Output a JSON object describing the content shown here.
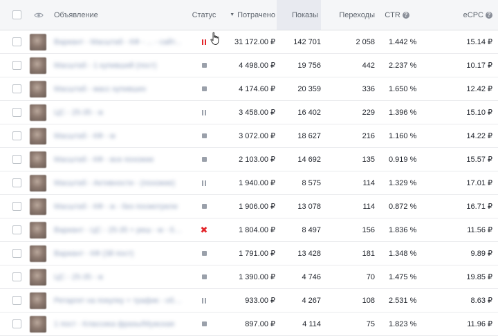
{
  "header": {
    "ad": "Объявление",
    "status": "Статус",
    "spent": "Потрачено",
    "shows": "Показы",
    "clicks": "Переходы",
    "ctr": "CTR",
    "ecpc": "eCPC",
    "help_glyph": "?",
    "sort_glyph": "▼"
  },
  "status_glyphs": {
    "error": "✖"
  },
  "rows": [
    {
      "name": "Вариант - Масштаб - КФ - ... - сайт...",
      "status": "pause-red",
      "spent": "31 172.00 ₽",
      "shows": "142 701",
      "clicks": "2 058",
      "ctr": "1.442 %",
      "ecpc": "15.14 ₽"
    },
    {
      "name": "Масштаб - 1 купивший (пост)",
      "status": "stop",
      "spent": "4 498.00 ₽",
      "shows": "19 756",
      "clicks": "442",
      "ctr": "2.237 %",
      "ecpc": "10.17 ₽"
    },
    {
      "name": "Масштаб - масс купивших",
      "status": "stop",
      "spent": "4 174.60 ₽",
      "shows": "20 359",
      "clicks": "336",
      "ctr": "1.650 %",
      "ecpc": "12.42 ₽"
    },
    {
      "name": "ЦС - 25-35 - ж",
      "status": "pause",
      "spent": "3 458.00 ₽",
      "shows": "16 402",
      "clicks": "229",
      "ctr": "1.396 %",
      "ecpc": "15.10 ₽"
    },
    {
      "name": "Масштаб - КФ - м",
      "status": "stop",
      "spent": "3 072.00 ₽",
      "shows": "18 627",
      "clicks": "216",
      "ctr": "1.160 %",
      "ecpc": "14.22 ₽"
    },
    {
      "name": "Масштаб - КФ - все похожие",
      "status": "stop",
      "spent": "2 103.00 ₽",
      "shows": "14 692",
      "clicks": "135",
      "ctr": "0.919 %",
      "ecpc": "15.57 ₽"
    },
    {
      "name": "Масштаб - Активности - (похожие)",
      "status": "pause",
      "spent": "1 940.00 ₽",
      "shows": "8 575",
      "clicks": "114",
      "ctr": "1.329 %",
      "ecpc": "17.01 ₽"
    },
    {
      "name": "Масштаб - КФ - ж - без посмотрели",
      "status": "stop",
      "spent": "1 906.00 ₽",
      "shows": "13 078",
      "clicks": "114",
      "ctr": "0.872 %",
      "ecpc": "16.71 ₽"
    },
    {
      "name": "Вариант - ЦС - 25-35 + реш - м - без...",
      "status": "error",
      "spent": "1 804.00 ₽",
      "shows": "8 497",
      "clicks": "156",
      "ctr": "1.836 %",
      "ecpc": "11.56 ₽"
    },
    {
      "name": "Вариант - КФ (3й пост)",
      "status": "stop",
      "spent": "1 791.00 ₽",
      "shows": "13 428",
      "clicks": "181",
      "ctr": "1.348 %",
      "ecpc": "9.89 ₽"
    },
    {
      "name": "ЦС - 25-35 - ж",
      "status": "stop",
      "spent": "1 390.00 ₽",
      "shows": "4 746",
      "clicks": "70",
      "ctr": "1.475 %",
      "ecpc": "19.85 ₽"
    },
    {
      "name": "Ретаргет на покупку + трафик - общ...",
      "status": "pause",
      "spent": "933.00 ₽",
      "shows": "4 267",
      "clicks": "108",
      "ctr": "2.531 %",
      "ecpc": "8.63 ₽"
    },
    {
      "name": "1 пост - Классика фразы/Мужская",
      "status": "stop",
      "spent": "897.00 ₽",
      "shows": "4 114",
      "clicks": "75",
      "ctr": "1.823 %",
      "ecpc": "11.96 ₽"
    }
  ]
}
